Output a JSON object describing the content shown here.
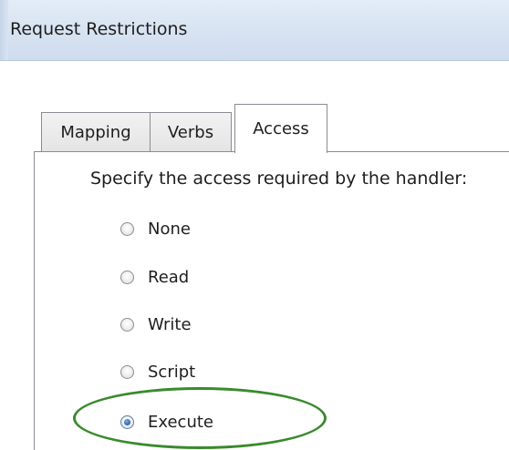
{
  "dialog": {
    "title": "Request Restrictions"
  },
  "tabs": [
    {
      "label": "Mapping",
      "selected": false
    },
    {
      "label": "Verbs",
      "selected": false
    },
    {
      "label": "Access",
      "selected": true
    }
  ],
  "access": {
    "prompt": "Specify the access required by the handler:",
    "options": [
      {
        "label": "None",
        "checked": false
      },
      {
        "label": "Read",
        "checked": false
      },
      {
        "label": "Write",
        "checked": false
      },
      {
        "label": "Script",
        "checked": false
      },
      {
        "label": "Execute",
        "checked": true
      }
    ],
    "selected": "Execute"
  },
  "annotation": {
    "highlight_color": "#3a8a2d",
    "highlighted_option": "Execute"
  }
}
